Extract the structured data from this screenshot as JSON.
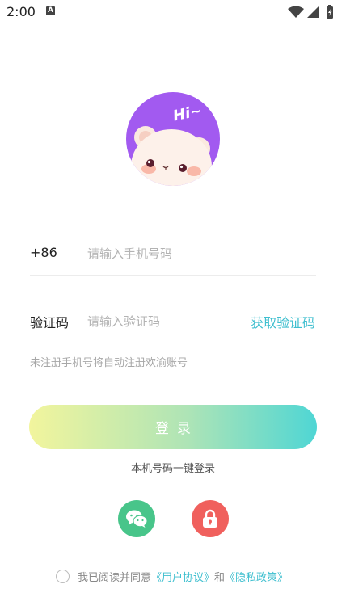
{
  "status_bar": {
    "time": "2:00",
    "notification_letter": "A"
  },
  "avatar": {
    "greeting": "Hi~"
  },
  "phone_row": {
    "country_code": "+86",
    "placeholder": "请输入手机号码"
  },
  "code_row": {
    "label": "验证码",
    "placeholder": "请输入验证码",
    "get_code": "获取验证码"
  },
  "hint": "未注册手机号将自动注册欢渝账号",
  "login_button": "登录",
  "one_key_login": "本机号码一键登录",
  "social": {
    "wechat_icon": "wechat-icon",
    "lock_icon": "lock-icon"
  },
  "agreement": {
    "prefix": "我已阅读并同意",
    "user_agreement": "《用户协议》",
    "and": "和",
    "privacy_policy": "《隐私政策》"
  },
  "colors": {
    "accent": "#3fbfcf",
    "avatar_bg": "#a25af0",
    "wechat": "#48c58a",
    "lock": "#f0605d"
  }
}
